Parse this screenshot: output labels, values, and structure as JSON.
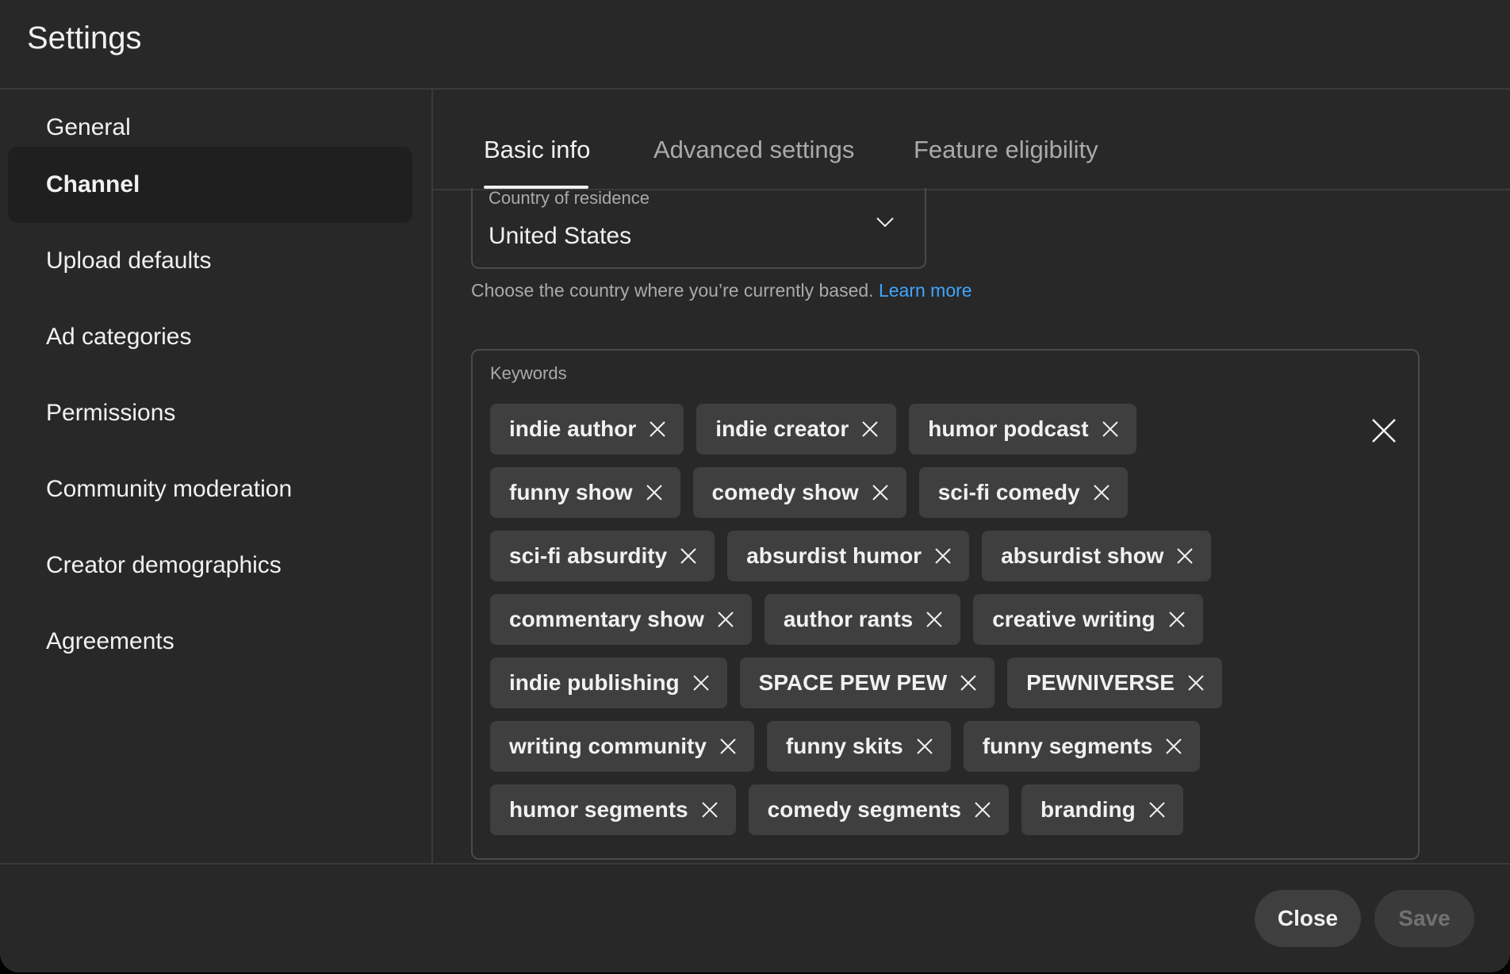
{
  "header": {
    "title": "Settings"
  },
  "sidebar": {
    "items": [
      {
        "label": "General"
      },
      {
        "label": "Channel",
        "active": true
      },
      {
        "label": "Upload defaults"
      },
      {
        "label": "Ad categories"
      },
      {
        "label": "Permissions"
      },
      {
        "label": "Community moderation"
      },
      {
        "label": "Creator demographics"
      },
      {
        "label": "Agreements"
      }
    ]
  },
  "tabs": [
    {
      "label": "Basic info",
      "active": true
    },
    {
      "label": "Advanced settings"
    },
    {
      "label": "Feature eligibility"
    }
  ],
  "country": {
    "label": "Country of residence",
    "value": "United States",
    "helper_text": "Choose the country where you’re currently based.",
    "learn_more": "Learn more"
  },
  "keywords": {
    "label": "Keywords",
    "rows": [
      [
        "indie author",
        "indie creator",
        "humor podcast"
      ],
      [
        "funny show",
        "comedy show",
        "sci-fi comedy"
      ],
      [
        "sci-fi absurdity",
        "absurdist humor",
        "absurdist show"
      ],
      [
        "commentary show",
        "author rants",
        "creative writing"
      ],
      [
        "indie publishing",
        "SPACE PEW PEW",
        "PEWNIVERSE"
      ],
      [
        "writing community",
        "funny skits",
        "funny segments"
      ],
      [
        "humor segments",
        "comedy segments",
        "branding"
      ]
    ]
  },
  "footer": {
    "close_label": "Close",
    "save_label": "Save"
  },
  "colors": {
    "background": "#282828",
    "chip": "#3f3f3f",
    "link": "#3ea6ff",
    "text": "#f1f1f1",
    "muted_text": "#aaaaaa"
  }
}
